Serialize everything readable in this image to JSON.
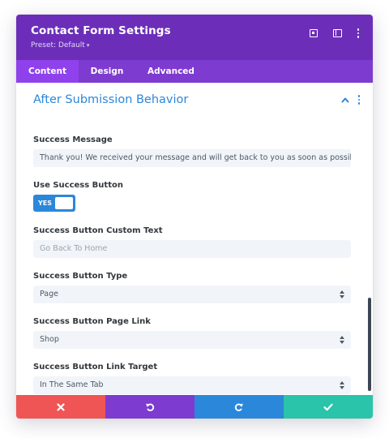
{
  "header": {
    "title": "Contact Form Settings",
    "preset_label": "Preset: Default",
    "icons": [
      "expand-icon",
      "split-view-icon",
      "more-options-icon"
    ]
  },
  "tabs": [
    {
      "label": "Content",
      "active": true
    },
    {
      "label": "Design",
      "active": false
    },
    {
      "label": "Advanced",
      "active": false
    }
  ],
  "section": {
    "title": "After Submission Behavior",
    "collapsed": false
  },
  "fields": {
    "success_message": {
      "label": "Success Message",
      "value": "Thank you! We received your message and will get back to you as soon as possible!"
    },
    "use_success_button": {
      "label": "Use Success Button",
      "toggle_text": "YES",
      "enabled": true
    },
    "custom_text": {
      "label": "Success Button Custom Text",
      "value": "",
      "placeholder": "Go Back To Home"
    },
    "button_type": {
      "label": "Success Button Type",
      "selected": "Page"
    },
    "page_link": {
      "label": "Success Button Page Link",
      "selected": "Shop"
    },
    "link_target": {
      "label": "Success Button Link Target",
      "selected": "In The Same Tab"
    }
  },
  "footer": {
    "buttons": [
      "cancel-icon",
      "undo-icon",
      "redo-icon",
      "save-icon"
    ]
  },
  "colors": {
    "header_bg": "#6c2eb9",
    "tabs_bg": "#7e3bd0",
    "active_tab_bg": "#8f42ec",
    "accent_blue": "#2b87da",
    "cancel": "#ef5555",
    "undo": "#7e3bd0",
    "redo": "#2b87da",
    "save": "#29c4a9"
  }
}
